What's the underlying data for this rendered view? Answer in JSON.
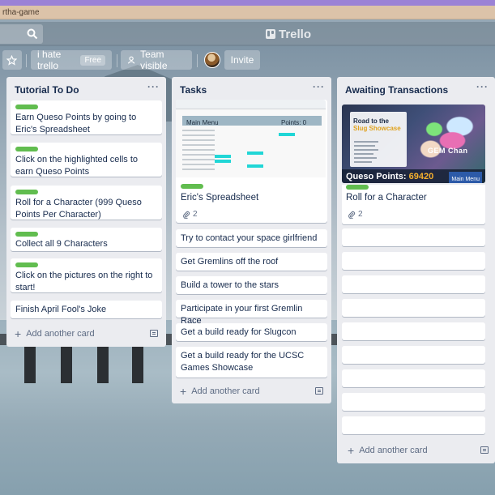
{
  "browser": {
    "url_fragment": "rtha-game"
  },
  "header": {
    "logo_text": "Trello"
  },
  "board_bar": {
    "board_name": "i hate trello",
    "plan_badge": "Free",
    "visibility": "Team visible",
    "invite_label": "Invite"
  },
  "lists": [
    {
      "title": "Tutorial To Do",
      "cards": [
        {
          "text": "Earn Queso Points by going to Eric's Spreadsheet",
          "label": "green"
        },
        {
          "text": "Click on the highlighted cells to earn Queso Points",
          "label": "green"
        },
        {
          "text": "Roll for a Character (999 Queso Points Per Character)",
          "label": "green"
        },
        {
          "text": "Collect all 9 Characters",
          "label": "green"
        },
        {
          "text": "Click on the pictures on the right to start!",
          "label": "green"
        },
        {
          "text": "Finish April Fool's Joke"
        }
      ],
      "add_card": "Add another card"
    },
    {
      "title": "Tasks",
      "cards": [
        {
          "text": "Eric's Spreadsheet",
          "attachments": "2",
          "label": "green",
          "cover": {
            "sheet_title": "Main Menu",
            "points_label": "Points: 0"
          }
        },
        {
          "text": "Try to contact your space girlfriend"
        },
        {
          "text": "Get Gremlins off the roof"
        },
        {
          "text": "Build a tower to the stars"
        },
        {
          "text": "Participate in your first Gremlin Race"
        },
        {
          "text": "Get a build ready for Slugcon"
        },
        {
          "text": "Get a build ready for the UCSC Games Showcase"
        }
      ],
      "add_card": "Add another card"
    },
    {
      "title": "Awaiting Transactions",
      "cards": [
        {
          "text": "Roll for a Character",
          "attachments": "2",
          "label": "green",
          "cover": {
            "line1": "Road to the",
            "line2": "Slug Showcase",
            "character_name": "GEM Chan",
            "points_label": "Queso Points:",
            "points_value": "69420",
            "menu_button": "Main Menu"
          }
        }
      ],
      "empty_card_count": 10,
      "add_card": "Add another card"
    }
  ],
  "colors": {
    "label_green": "#61bd4f",
    "list_bg": "#ebecf0",
    "highlight_cyan": "#21d6d6"
  }
}
